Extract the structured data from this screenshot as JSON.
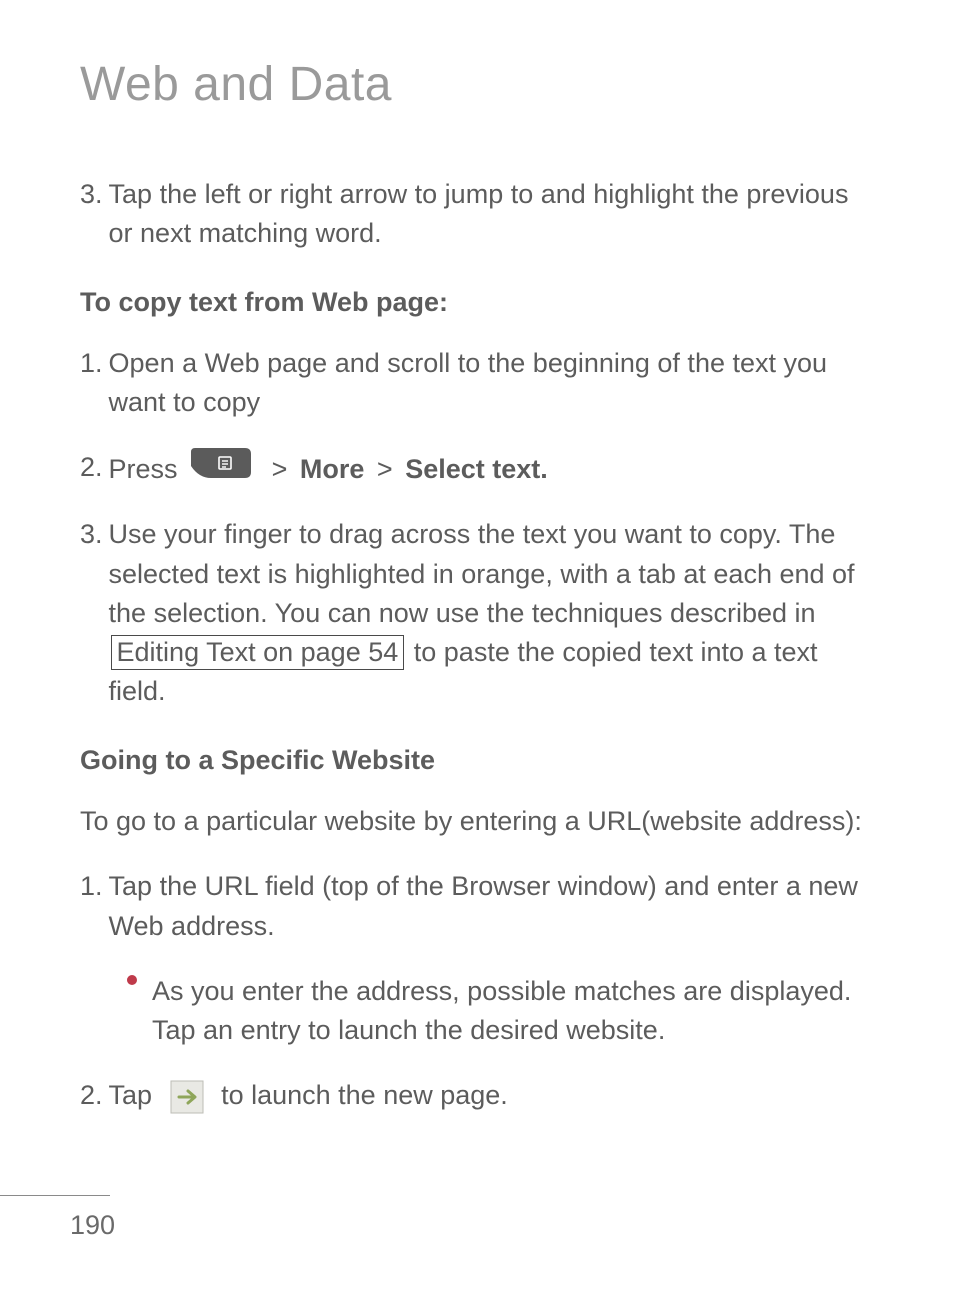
{
  "page_title": "Web and Data",
  "step_a": {
    "num": "3.",
    "text": "Tap the left or right arrow to jump to and highlight the previous or next matching word."
  },
  "sub_copy": "To copy text from Web page:",
  "copy_step1": {
    "num": "1.",
    "text": "Open a Web page and scroll to the beginning of the text you want to copy"
  },
  "copy_step2": {
    "num": "2.",
    "press": "Press",
    "sep1": ">",
    "more": "More",
    "sep2": ">",
    "select_text": "Select text."
  },
  "copy_step3": {
    "num": "3.",
    "p1": "Use your finger to drag across the text you want to copy. The selected text is highlighted in orange, with a tab at each end of the selection. You can now use the techniques described in ",
    "link": "Editing Text on page 54",
    "p2": " to paste the copied text into a text field."
  },
  "sub_goto": "Going to a Specific Website",
  "goto_intro": "To go to a particular website by entering a URL(website address):",
  "goto_step1": {
    "num": "1.",
    "text": "Tap the URL field (top of the Browser window) and enter a new Web address."
  },
  "goto_bullet": "As you enter the address, possible matches are displayed. Tap an entry to launch the desired website.",
  "goto_step2": {
    "num": "2.",
    "pre": "Tap ",
    "post": " to launch the new page."
  },
  "page_number": "190"
}
